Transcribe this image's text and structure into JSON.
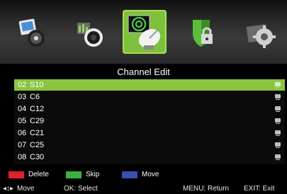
{
  "menu": {
    "icons": [
      "media-icon",
      "speaker-icon",
      "satellite-dish-icon",
      "lock-icon",
      "gear-icon"
    ],
    "active_index": 2
  },
  "title": "Channel Edit",
  "channels": [
    {
      "num": "02",
      "name": "S10"
    },
    {
      "num": "03",
      "name": "C6"
    },
    {
      "num": "04",
      "name": "C12"
    },
    {
      "num": "05",
      "name": "C29"
    },
    {
      "num": "06",
      "name": "C21"
    },
    {
      "num": "07",
      "name": "C25"
    },
    {
      "num": "08",
      "name": "C30"
    }
  ],
  "selected_channel": 0,
  "legend": {
    "delete": {
      "label": "Delete",
      "color": "#e0202a"
    },
    "skip": {
      "label": "Skip",
      "color": "#3cb043"
    },
    "move": {
      "label": "Move",
      "color": "#3a4db0"
    }
  },
  "help": {
    "move": "Move",
    "ok": "OK: Select",
    "menu": "MENU: Return",
    "exit": "EXIT: Exit"
  }
}
